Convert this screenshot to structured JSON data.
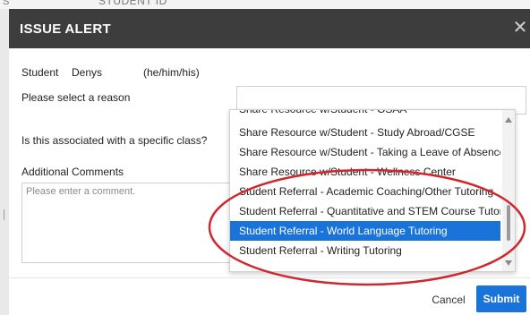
{
  "background": {
    "partial_text": "STUDENT ID",
    "partial_letter": "S"
  },
  "dialog": {
    "title": "ISSUE ALERT",
    "close_icon": "close-icon",
    "student_label": "Student",
    "student_name": "Denys",
    "pronouns": "(he/him/his)",
    "reason_label": "Please select a reason",
    "class_label": "Is this associated with a specific class?",
    "comments_label": "Additional Comments",
    "comments_placeholder": "Please enter a comment."
  },
  "dropdown": {
    "options": [
      "Share Resource w/Student - OSAA",
      "Share Resource w/Student - Study Abroad/CGSE",
      "Share Resource w/Student - Taking a Leave of Absence",
      "Share Resource w/Student - Wellness Center",
      "Student Referral - Academic Coaching/Other Tutoring",
      "Student Referral - Quantitative and STEM Course Tutoring",
      "Student Referral - World Language Tutoring",
      "Student Referral - Writing Tutoring"
    ],
    "selected_index": 6
  },
  "footer": {
    "cancel_label": "Cancel",
    "submit_label": "Submit"
  },
  "colors": {
    "accent": "#1a73d9",
    "titlebar": "#3d3d3d",
    "annotation": "#d0262e"
  }
}
